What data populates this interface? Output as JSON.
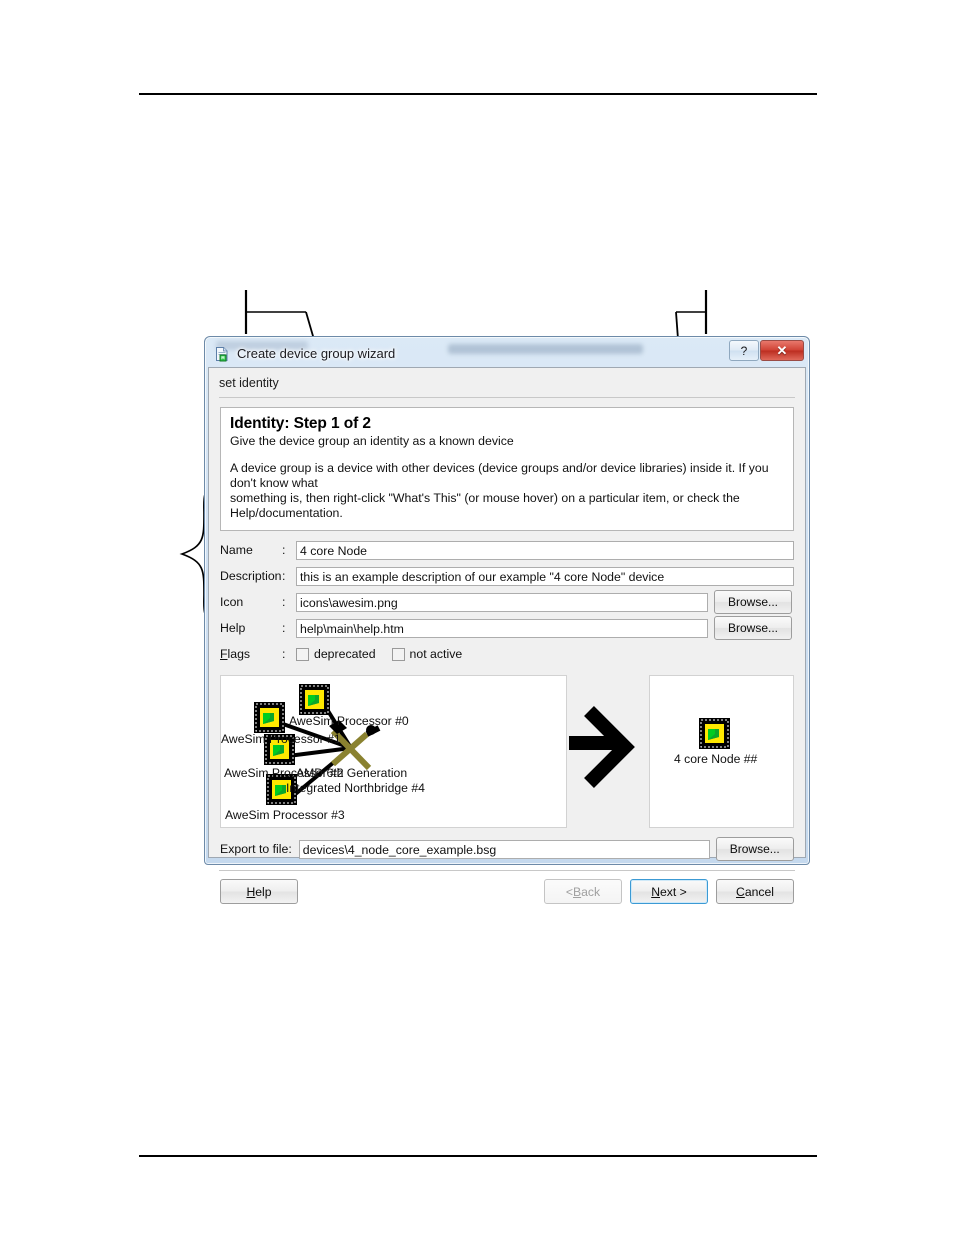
{
  "window": {
    "title": "Create device group wizard",
    "icon": "document-green-icon",
    "help_button": "?",
    "close_button": "✕"
  },
  "banner": {
    "text": "set identity"
  },
  "instructions": {
    "title": "Identity: Step 1 of 2",
    "subtitle": "Give the device group an identity as a known device",
    "body_line1": "A device group is a device with other devices (device groups and/or device libraries) inside it.  If you don't know what",
    "body_line2": "something is, then right-click \"What's This\" (or mouse hover) on a particular item, or check the Help/documentation."
  },
  "form": {
    "colon": ":",
    "rows": [
      {
        "label": "Name",
        "value": "4 core Node",
        "browse": null
      },
      {
        "label": "Description",
        "value": "this is an example description of our example \"4 core Node\" device",
        "browse": null
      },
      {
        "label": "Icon",
        "value": "icons\\awesim.png",
        "browse": "Browse..."
      },
      {
        "label": "Help",
        "value": "help\\main\\help.htm",
        "browse": "Browse..."
      }
    ],
    "flags": {
      "label_pre": "F",
      "label_post": "lags",
      "deprecated": "deprecated",
      "not_active": "not active",
      "deprecated_checked": false,
      "not_active_checked": false
    }
  },
  "preview": {
    "left_nodes": [
      {
        "label": "AweSim Processor #0"
      },
      {
        "label": "AweSim Processor #1"
      },
      {
        "label": "AweSim Processor #2"
      },
      {
        "label": "AweSim Processor #3"
      },
      {
        "label": "AMD 6th Generation"
      },
      {
        "label": "Integrated Northbridge #4"
      }
    ],
    "arrow": "arrow-right-icon",
    "right_node": {
      "label": "4 core Node ##"
    }
  },
  "export": {
    "label": "Export to file:",
    "value": "devices\\4_node_core_example.bsg",
    "browse": "Browse..."
  },
  "buttons": {
    "help": "Help",
    "help_mnem": "H",
    "back": "< Back",
    "back_mnem": "B",
    "next": "Next >",
    "next_mnem": "N",
    "cancel": "Cancel",
    "cancel_mnem": "C"
  },
  "colors": {
    "accent": "#3c9ad4",
    "close": "#d04335",
    "titlebar": "#cfe0f2",
    "client": "#f0f0f0",
    "icon_yellow": "#ffe800",
    "icon_green": "#00cc22"
  }
}
